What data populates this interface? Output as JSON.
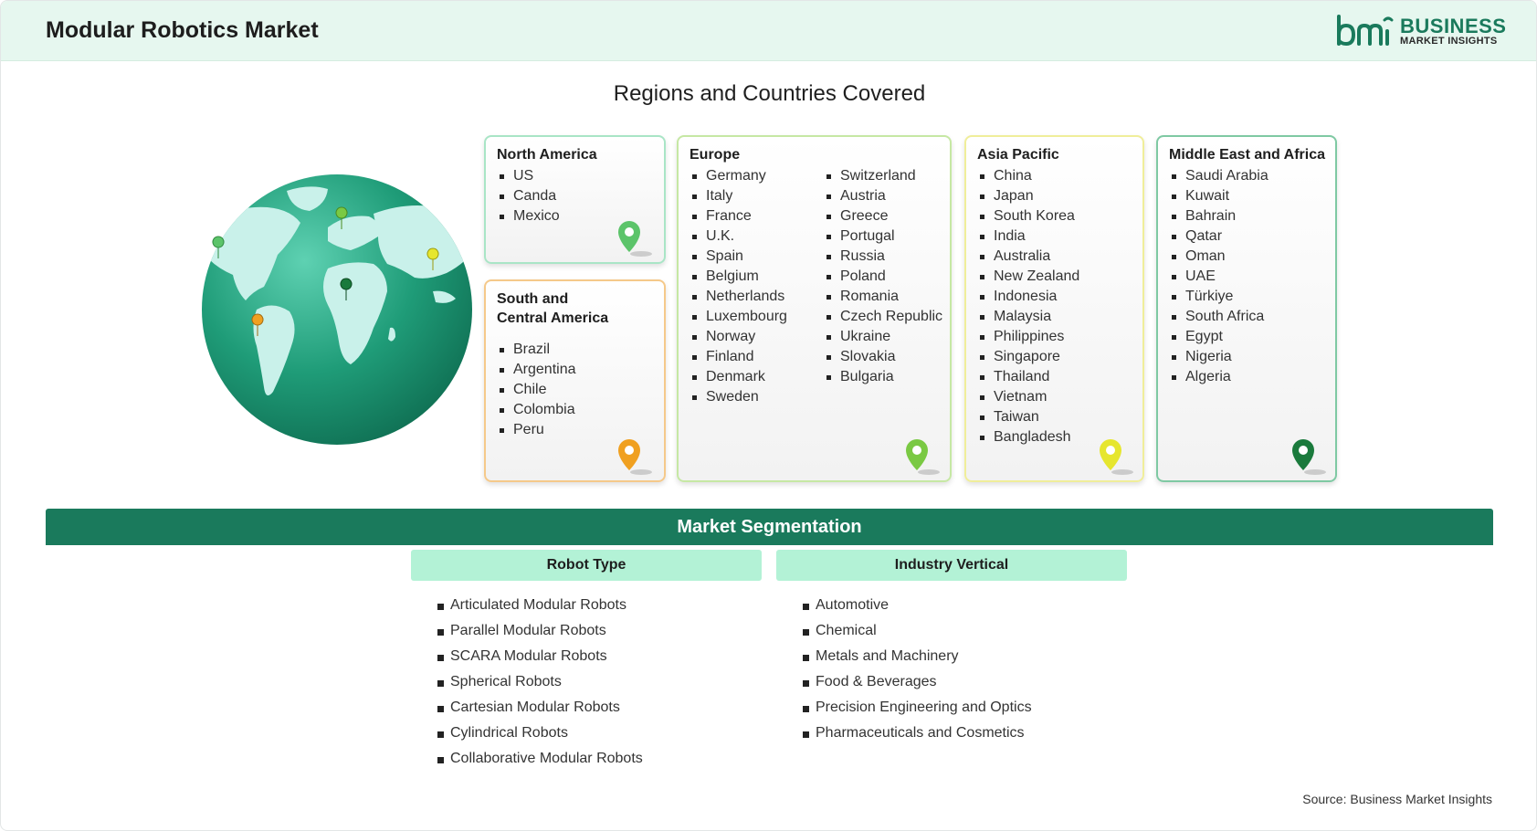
{
  "header": {
    "title": "Modular Robotics Market",
    "logo": {
      "mark": "bmi",
      "word1": "BUSINESS",
      "word2": "MARKET INSIGHTS",
      "color": "#1a7a5c"
    }
  },
  "regions_title": "Regions and Countries Covered",
  "regions": {
    "north_america": {
      "title": "North America",
      "countries": [
        "US",
        "Canda",
        "Mexico"
      ],
      "pin_color": "#5cc46a"
    },
    "south_america": {
      "title_line1": "South and",
      "title_line2": "Central America",
      "countries": [
        "Brazil",
        "Argentina",
        "Chile",
        "Colombia",
        "Peru"
      ],
      "pin_color": "#f0a020"
    },
    "europe": {
      "title": "Europe",
      "countries_col1": [
        "Germany",
        "Italy",
        "France",
        "U.K.",
        "Spain",
        "Belgium",
        "Netherlands",
        "Luxembourg",
        "Norway",
        "Finland",
        "Denmark",
        "Sweden"
      ],
      "countries_col2": [
        "Switzerland",
        "Austria",
        "Greece",
        "Portugal",
        "Russia",
        "Poland",
        "Romania",
        "Czech Republic",
        "Ukraine",
        "Slovakia",
        "Bulgaria"
      ],
      "pin_color": "#7ac943"
    },
    "asia_pacific": {
      "title": "Asia Pacific",
      "countries": [
        "China",
        "Japan",
        "South Korea",
        "India",
        "Australia",
        "New Zealand",
        "Indonesia",
        "Malaysia",
        "Philippines",
        "Singapore",
        "Thailand",
        "Vietnam",
        "Taiwan",
        "Bangladesh"
      ],
      "pin_color": "#e6e62e"
    },
    "middle_east_africa": {
      "title": "Middle East and Africa",
      "countries": [
        "Saudi Arabia",
        "Kuwait",
        "Bahrain",
        "Qatar",
        "Oman",
        "UAE",
        "Türkiye",
        "South Africa",
        "Egypt",
        "Nigeria",
        "Algeria"
      ],
      "pin_color": "#1a7a3c"
    }
  },
  "segmentation": {
    "title": "Market Segmentation",
    "robot_type": {
      "title": "Robot Type",
      "items": [
        "Articulated Modular Robots",
        "Parallel Modular Robots",
        "SCARA Modular Robots",
        "Spherical Robots",
        "Cartesian Modular Robots",
        "Cylindrical Robots",
        "Collaborative Modular Robots"
      ]
    },
    "industry_vertical": {
      "title": "Industry Vertical",
      "items": [
        "Automotive",
        "Chemical",
        "Metals and Machinery",
        "Food & Beverages",
        "Precision Engineering and Optics",
        "Pharmaceuticals and Cosmetics"
      ]
    }
  },
  "source": "Source: Business Market Insights",
  "colors": {
    "brand_green": "#1a7a5c",
    "header_bg": "#e6f7ef",
    "column_head_bg": "#b3f2d6"
  }
}
